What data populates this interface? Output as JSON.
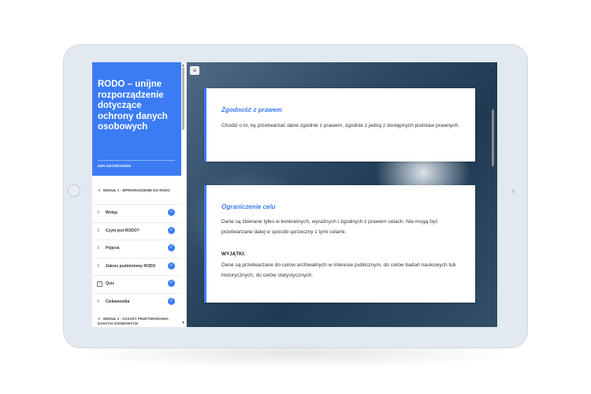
{
  "course": {
    "title": "RODO – unijne rozporządzenie dotyczące ochrony danych osobowych",
    "progress_label": "53% UKOŃCZONO"
  },
  "modules": [
    {
      "title": "MODUŁ 1 - WPROWADZENIE DO RODO",
      "lessons": [
        {
          "label": "Wstęp",
          "icon": "text-lines-icon",
          "completed": true
        },
        {
          "label": "Czym jest RODO?",
          "icon": "text-lines-icon",
          "completed": true
        },
        {
          "label": "Pojęcia",
          "icon": "text-lines-icon",
          "completed": true
        },
        {
          "label": "Zakres podmiotowy RODO",
          "icon": "text-lines-icon",
          "completed": true
        },
        {
          "label": "Quiz",
          "icon": "quiz-icon",
          "completed": true
        },
        {
          "label": "Ciekawostka",
          "icon": "text-lines-icon",
          "completed": true
        }
      ]
    },
    {
      "title": "MODUŁ 2 - ZASADY PRZETWARZANIA DANYCH OSOBOWYCH",
      "lessons": []
    }
  ],
  "content": {
    "cards": [
      {
        "title": "Zgodność z prawem",
        "text": "Chodzi o to, by przetwarzać dane zgodnie z prawem, zgodnie z jedną z dostępnych podstaw prawnych."
      },
      {
        "title": "Ograniczenie celu",
        "text": "Dane są zbierane tylko w konkretnych, wyraźnych i zgodnych z prawem celach. Nie mogą być przetwarzane dalej w sposób sprzeczny z tymi celami.",
        "label": "WYJĄTKI:",
        "extra": "Dane są przetwarzane do celów archiwalnych w interesie publicznym, do celów badań naukowych lub historycznych, do celów statystycznych."
      }
    ]
  },
  "colors": {
    "accent": "#3b7cf5",
    "device": "#e3e9f1"
  }
}
